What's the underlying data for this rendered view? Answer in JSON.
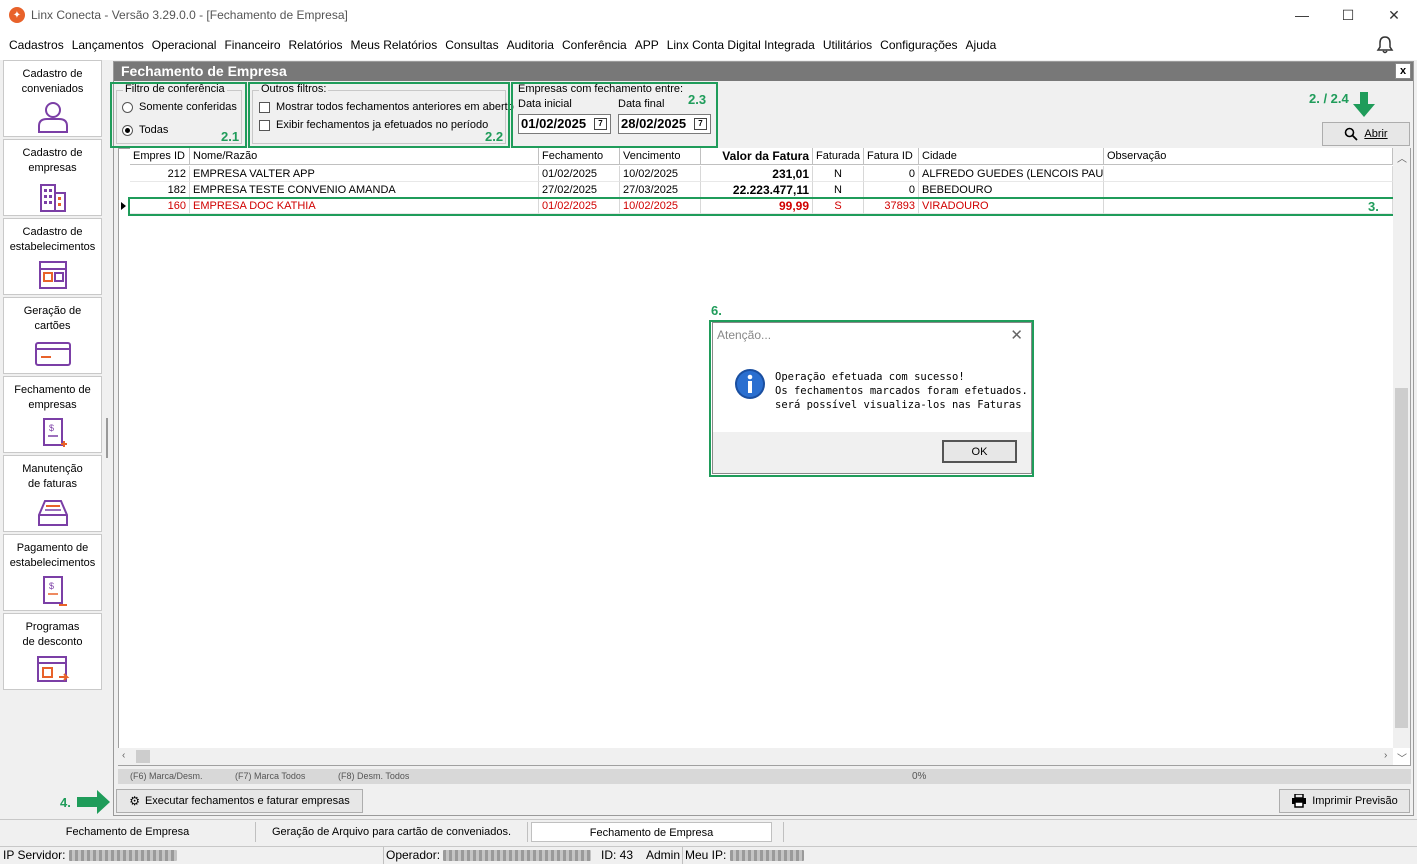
{
  "window": {
    "title": "Linx Conecta - Versão 3.29.0.0 - [Fechamento de Empresa]"
  },
  "menu": [
    "Cadastros",
    "Lançamentos",
    "Operacional",
    "Financeiro",
    "Relatórios",
    "Meus Relatórios",
    "Consultas",
    "Auditoria",
    "Conferência",
    "APP",
    "Linx Conta Digital Integrada",
    "Utilitários",
    "Configurações",
    "Ajuda"
  ],
  "sidebar": [
    {
      "line1": "Cadastro de",
      "line2": "conveniados",
      "icon": "user-icon"
    },
    {
      "line1": "Cadastro de",
      "line2": "empresas",
      "icon": "building-icon"
    },
    {
      "line1": "Cadastro de",
      "line2": "estabelecimentos",
      "icon": "store-icon"
    },
    {
      "line1": "Geração de",
      "line2": "cartões",
      "icon": "card-icon"
    },
    {
      "line1": "Fechamento de",
      "line2": "empresas",
      "icon": "invoice-icon"
    },
    {
      "line1": "Manutenção",
      "line2": "de faturas",
      "icon": "tray-icon"
    },
    {
      "line1": "Pagamento de",
      "line2": "estabelecimentos",
      "icon": "payment-icon"
    },
    {
      "line1": "Programas",
      "line2": "de desconto",
      "icon": "discount-icon"
    }
  ],
  "panel": {
    "title": "Fechamento de Empresa",
    "close": "x"
  },
  "filters": {
    "conferencia": {
      "title": "Filtro de conferência",
      "opt1": "Somente conferidas",
      "opt2": "Todas",
      "selected": "Todas"
    },
    "outros": {
      "title": "Outros filtros:",
      "opt1": "Mostrar todos fechamentos anteriores em aberto",
      "opt2": "Exibir fechamentos ja efetuados no período"
    },
    "periodo": {
      "title": "Empresas com fechamento entre:",
      "label_inicial": "Data inicial",
      "label_final": "Data final",
      "data_inicial": "01/02/2025",
      "data_final": "28/02/2025"
    }
  },
  "markers": {
    "m21": "2.1",
    "m22": "2.2",
    "m23": "2.3",
    "m24": "2. / 2.4",
    "m3": "3.",
    "m4": "4.",
    "m6": "6."
  },
  "buttons": {
    "abrir": "Abrir",
    "executar": "Executar fechamentos e faturar empresas",
    "imprimir": "Imprimir Previsão",
    "ok": "OK"
  },
  "grid": {
    "columns": [
      "Empres ID",
      "Nome/Razão",
      "Fechamento",
      "Vencimento",
      "Valor da Fatura",
      "Faturada",
      "Fatura ID",
      "Cidade",
      "Observação"
    ],
    "rows": [
      {
        "id": "212",
        "nome": "EMPRESA VALTER APP",
        "fechamento": "01/02/2025",
        "vencimento": "10/02/2025",
        "valor": "231,01",
        "faturada": "N",
        "fatura_id": "0",
        "cidade": "ALFREDO GUEDES (LENCOIS PAUL",
        "obs": ""
      },
      {
        "id": "182",
        "nome": "EMPRESA TESTE CONVENIO AMANDA",
        "fechamento": "27/02/2025",
        "vencimento": "27/03/2025",
        "valor": "22.223.477,11",
        "faturada": "N",
        "fatura_id": "0",
        "cidade": "BEBEDOURO",
        "obs": ""
      },
      {
        "id": "160",
        "nome": "EMPRESA DOC KATHIA",
        "fechamento": "01/02/2025",
        "vencimento": "10/02/2025",
        "valor": "99,99",
        "faturada": "S",
        "fatura_id": "37893",
        "cidade": "VIRADOURO",
        "obs": ""
      }
    ]
  },
  "shortcuts": {
    "f6": "(F6) Marca/Desm.",
    "f7": "(F7) Marca Todos",
    "f8": "(F8) Desm. Todos",
    "progress": "0%"
  },
  "dialog": {
    "title": "Atenção...",
    "line1": "Operação efetuada com sucesso!",
    "line2": "Os fechamentos marcados foram efetuados.",
    "line3": "será possível visualiza-los nas Faturas"
  },
  "tabs": [
    "Fechamento de Empresa",
    "Geração de Arquivo para cartão de conveniados.",
    "Fechamento de Empresa"
  ],
  "status": {
    "ip_servidor": "IP Servidor:",
    "operador": "Operador:",
    "id": "ID: 43",
    "perfil": "Admin",
    "meu_ip": "Meu IP:"
  },
  "colors": {
    "highlight": "#1f9c5a",
    "selected_row": "#d00000",
    "panel_title": "#787878",
    "info_icon": "#1a4fa0"
  }
}
